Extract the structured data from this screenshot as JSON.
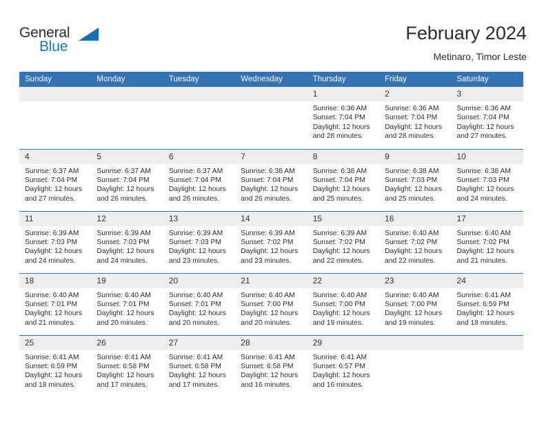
{
  "brand": {
    "name_part1": "General",
    "name_part2": "Blue",
    "accent_color": "#1479c4",
    "logo_triangle_color": "#1471b8"
  },
  "header": {
    "title": "February 2024",
    "subtitle": "Metinaro, Timor Leste"
  },
  "theme": {
    "header_blue": "#3372b5",
    "daynum_band": "#eeeeee",
    "text": "#2c2c2c"
  },
  "weekdays": [
    "Sunday",
    "Monday",
    "Tuesday",
    "Wednesday",
    "Thursday",
    "Friday",
    "Saturday"
  ],
  "labels": {
    "sunrise_prefix": "Sunrise: ",
    "sunset_prefix": "Sunset: ",
    "daylight_prefix": "Daylight: "
  },
  "weeks": [
    [
      {
        "day": "",
        "blank": true,
        "sunrise": "",
        "sunset": "",
        "daylight_line1": "",
        "daylight_line2": ""
      },
      {
        "day": "",
        "blank": true,
        "sunrise": "",
        "sunset": "",
        "daylight_line1": "",
        "daylight_line2": ""
      },
      {
        "day": "",
        "blank": true,
        "sunrise": "",
        "sunset": "",
        "daylight_line1": "",
        "daylight_line2": ""
      },
      {
        "day": "",
        "blank": true,
        "sunrise": "",
        "sunset": "",
        "daylight_line1": "",
        "daylight_line2": ""
      },
      {
        "day": "1",
        "blank": false,
        "sunrise": "Sunrise: 6:36 AM",
        "sunset": "Sunset: 7:04 PM",
        "daylight_line1": "Daylight: 12 hours",
        "daylight_line2": "and 28 minutes."
      },
      {
        "day": "2",
        "blank": false,
        "sunrise": "Sunrise: 6:36 AM",
        "sunset": "Sunset: 7:04 PM",
        "daylight_line1": "Daylight: 12 hours",
        "daylight_line2": "and 28 minutes."
      },
      {
        "day": "3",
        "blank": false,
        "sunrise": "Sunrise: 6:36 AM",
        "sunset": "Sunset: 7:04 PM",
        "daylight_line1": "Daylight: 12 hours",
        "daylight_line2": "and 27 minutes."
      }
    ],
    [
      {
        "day": "4",
        "blank": false,
        "sunrise": "Sunrise: 6:37 AM",
        "sunset": "Sunset: 7:04 PM",
        "daylight_line1": "Daylight: 12 hours",
        "daylight_line2": "and 27 minutes."
      },
      {
        "day": "5",
        "blank": false,
        "sunrise": "Sunrise: 6:37 AM",
        "sunset": "Sunset: 7:04 PM",
        "daylight_line1": "Daylight: 12 hours",
        "daylight_line2": "and 26 minutes."
      },
      {
        "day": "6",
        "blank": false,
        "sunrise": "Sunrise: 6:37 AM",
        "sunset": "Sunset: 7:04 PM",
        "daylight_line1": "Daylight: 12 hours",
        "daylight_line2": "and 26 minutes."
      },
      {
        "day": "7",
        "blank": false,
        "sunrise": "Sunrise: 6:38 AM",
        "sunset": "Sunset: 7:04 PM",
        "daylight_line1": "Daylight: 12 hours",
        "daylight_line2": "and 26 minutes."
      },
      {
        "day": "8",
        "blank": false,
        "sunrise": "Sunrise: 6:38 AM",
        "sunset": "Sunset: 7:04 PM",
        "daylight_line1": "Daylight: 12 hours",
        "daylight_line2": "and 25 minutes."
      },
      {
        "day": "9",
        "blank": false,
        "sunrise": "Sunrise: 6:38 AM",
        "sunset": "Sunset: 7:03 PM",
        "daylight_line1": "Daylight: 12 hours",
        "daylight_line2": "and 25 minutes."
      },
      {
        "day": "10",
        "blank": false,
        "sunrise": "Sunrise: 6:38 AM",
        "sunset": "Sunset: 7:03 PM",
        "daylight_line1": "Daylight: 12 hours",
        "daylight_line2": "and 24 minutes."
      }
    ],
    [
      {
        "day": "11",
        "blank": false,
        "sunrise": "Sunrise: 6:39 AM",
        "sunset": "Sunset: 7:03 PM",
        "daylight_line1": "Daylight: 12 hours",
        "daylight_line2": "and 24 minutes."
      },
      {
        "day": "12",
        "blank": false,
        "sunrise": "Sunrise: 6:39 AM",
        "sunset": "Sunset: 7:03 PM",
        "daylight_line1": "Daylight: 12 hours",
        "daylight_line2": "and 24 minutes."
      },
      {
        "day": "13",
        "blank": false,
        "sunrise": "Sunrise: 6:39 AM",
        "sunset": "Sunset: 7:03 PM",
        "daylight_line1": "Daylight: 12 hours",
        "daylight_line2": "and 23 minutes."
      },
      {
        "day": "14",
        "blank": false,
        "sunrise": "Sunrise: 6:39 AM",
        "sunset": "Sunset: 7:02 PM",
        "daylight_line1": "Daylight: 12 hours",
        "daylight_line2": "and 23 minutes."
      },
      {
        "day": "15",
        "blank": false,
        "sunrise": "Sunrise: 6:39 AM",
        "sunset": "Sunset: 7:02 PM",
        "daylight_line1": "Daylight: 12 hours",
        "daylight_line2": "and 22 minutes."
      },
      {
        "day": "16",
        "blank": false,
        "sunrise": "Sunrise: 6:40 AM",
        "sunset": "Sunset: 7:02 PM",
        "daylight_line1": "Daylight: 12 hours",
        "daylight_line2": "and 22 minutes."
      },
      {
        "day": "17",
        "blank": false,
        "sunrise": "Sunrise: 6:40 AM",
        "sunset": "Sunset: 7:02 PM",
        "daylight_line1": "Daylight: 12 hours",
        "daylight_line2": "and 21 minutes."
      }
    ],
    [
      {
        "day": "18",
        "blank": false,
        "sunrise": "Sunrise: 6:40 AM",
        "sunset": "Sunset: 7:01 PM",
        "daylight_line1": "Daylight: 12 hours",
        "daylight_line2": "and 21 minutes."
      },
      {
        "day": "19",
        "blank": false,
        "sunrise": "Sunrise: 6:40 AM",
        "sunset": "Sunset: 7:01 PM",
        "daylight_line1": "Daylight: 12 hours",
        "daylight_line2": "and 20 minutes."
      },
      {
        "day": "20",
        "blank": false,
        "sunrise": "Sunrise: 6:40 AM",
        "sunset": "Sunset: 7:01 PM",
        "daylight_line1": "Daylight: 12 hours",
        "daylight_line2": "and 20 minutes."
      },
      {
        "day": "21",
        "blank": false,
        "sunrise": "Sunrise: 6:40 AM",
        "sunset": "Sunset: 7:00 PM",
        "daylight_line1": "Daylight: 12 hours",
        "daylight_line2": "and 20 minutes."
      },
      {
        "day": "22",
        "blank": false,
        "sunrise": "Sunrise: 6:40 AM",
        "sunset": "Sunset: 7:00 PM",
        "daylight_line1": "Daylight: 12 hours",
        "daylight_line2": "and 19 minutes."
      },
      {
        "day": "23",
        "blank": false,
        "sunrise": "Sunrise: 6:40 AM",
        "sunset": "Sunset: 7:00 PM",
        "daylight_line1": "Daylight: 12 hours",
        "daylight_line2": "and 19 minutes."
      },
      {
        "day": "24",
        "blank": false,
        "sunrise": "Sunrise: 6:41 AM",
        "sunset": "Sunset: 6:59 PM",
        "daylight_line1": "Daylight: 12 hours",
        "daylight_line2": "and 18 minutes."
      }
    ],
    [
      {
        "day": "25",
        "blank": false,
        "sunrise": "Sunrise: 6:41 AM",
        "sunset": "Sunset: 6:59 PM",
        "daylight_line1": "Daylight: 12 hours",
        "daylight_line2": "and 18 minutes."
      },
      {
        "day": "26",
        "blank": false,
        "sunrise": "Sunrise: 6:41 AM",
        "sunset": "Sunset: 6:58 PM",
        "daylight_line1": "Daylight: 12 hours",
        "daylight_line2": "and 17 minutes."
      },
      {
        "day": "27",
        "blank": false,
        "sunrise": "Sunrise: 6:41 AM",
        "sunset": "Sunset: 6:58 PM",
        "daylight_line1": "Daylight: 12 hours",
        "daylight_line2": "and 17 minutes."
      },
      {
        "day": "28",
        "blank": false,
        "sunrise": "Sunrise: 6:41 AM",
        "sunset": "Sunset: 6:58 PM",
        "daylight_line1": "Daylight: 12 hours",
        "daylight_line2": "and 16 minutes."
      },
      {
        "day": "29",
        "blank": false,
        "sunrise": "Sunrise: 6:41 AM",
        "sunset": "Sunset: 6:57 PM",
        "daylight_line1": "Daylight: 12 hours",
        "daylight_line2": "and 16 minutes."
      },
      {
        "day": "",
        "blank": true,
        "sunrise": "",
        "sunset": "",
        "daylight_line1": "",
        "daylight_line2": ""
      },
      {
        "day": "",
        "blank": true,
        "sunrise": "",
        "sunset": "",
        "daylight_line1": "",
        "daylight_line2": ""
      }
    ]
  ]
}
